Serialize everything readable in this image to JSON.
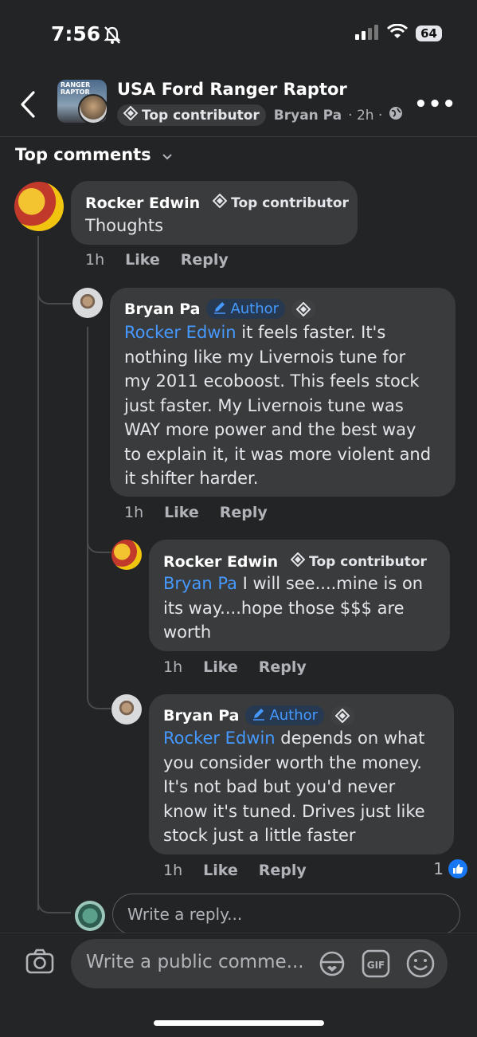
{
  "status_bar": {
    "time": "7:56",
    "battery": "64"
  },
  "header": {
    "group_name": "USA Ford Ranger Raptor",
    "badge": "Top contributor",
    "author": "Bryan Pa",
    "time": "· 2h ·",
    "thumb_text": "RANGER RAPTOR"
  },
  "sort_label": "Top comments",
  "comments": [
    {
      "name": "Rocker Edwin",
      "badge": "Top contributor",
      "text": "Thoughts",
      "time": "1h",
      "like": "Like",
      "reply": "Reply"
    },
    {
      "name": "Bryan Pa",
      "badge": "Author",
      "mention": "Rocker Edwin",
      "text_lines": [
        " it feels faster. It's",
        "nothing like my Livernois tune for",
        "my 2011 ecoboost. This feels stock",
        "just faster. My Livernois tune was",
        "WAY more power and the best way",
        "to explain it, it was more violent and",
        "it shifter harder."
      ],
      "time": "1h",
      "like": "Like",
      "reply": "Reply"
    },
    {
      "name": "Rocker Edwin",
      "badge": "Top contributor",
      "mention": "Bryan Pa",
      "text_lines": [
        " I will see....mine is on",
        "its way....hope those $$$ are",
        "worth"
      ],
      "time": "1h",
      "like": "Like",
      "reply": "Reply"
    },
    {
      "name": "Bryan Pa",
      "badge": "Author",
      "mention": "Rocker Edwin",
      "text_lines": [
        " depends on what",
        "you consider worth the money.",
        "It's not bad but you'd never",
        "know it's tuned. Drives just like",
        "stock just a little faster"
      ],
      "time": "1h",
      "like": "Like",
      "reply": "Reply",
      "reaction_count": "1"
    }
  ],
  "reply_placeholder": "Write a reply...",
  "public_placeholder": "Write a public comme...",
  "icons": [
    "back-icon",
    "more-icon",
    "top-contributor-icon",
    "globe-icon",
    "chevron-down-icon",
    "pencil-icon",
    "camera-icon",
    "avatar-sticker-icon",
    "gif-icon",
    "emoji-icon",
    "like-icon"
  ],
  "colors": {
    "background": "#232426",
    "bubble": "#3a3b3c",
    "mention": "#4599ff",
    "like": "#1877f2"
  }
}
